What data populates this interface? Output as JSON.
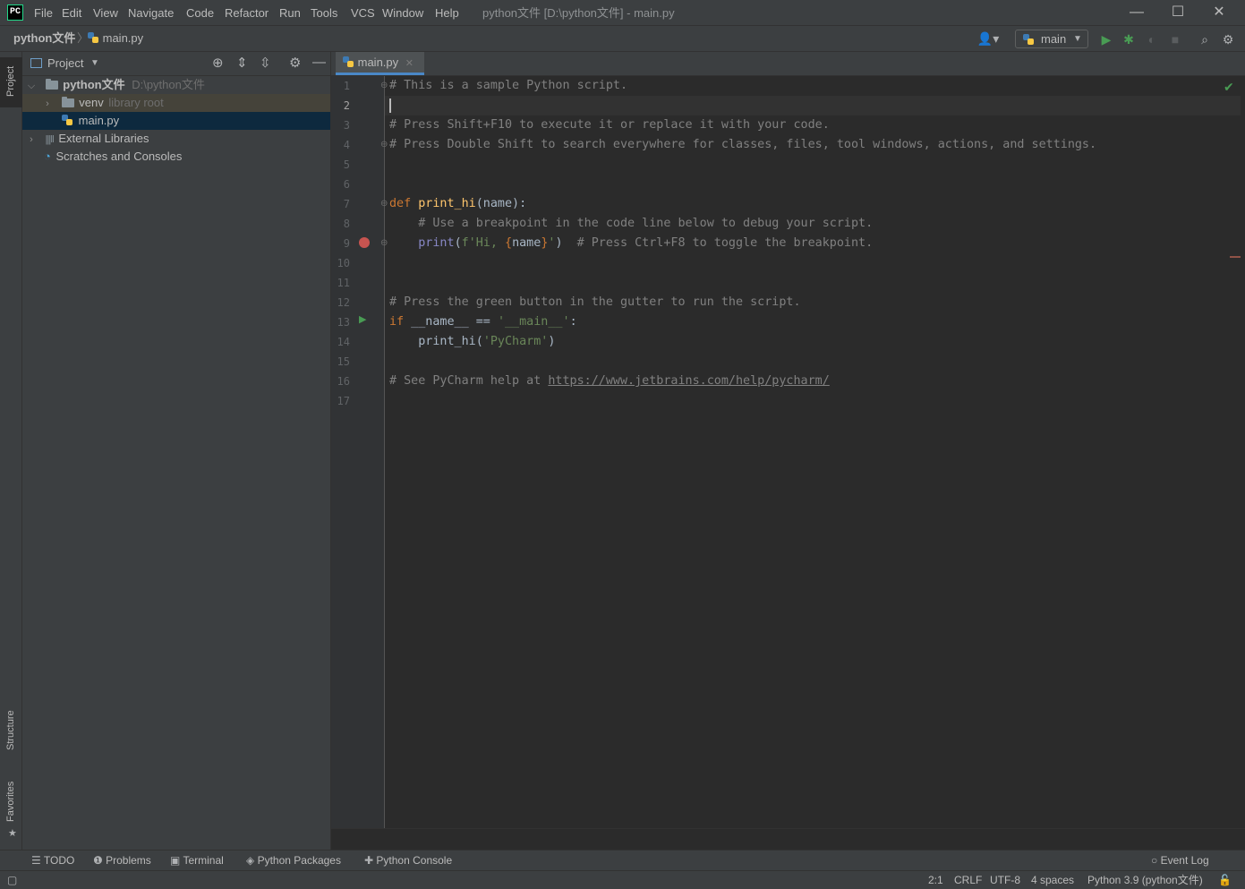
{
  "titlebar": {
    "logo": "PC",
    "menu": [
      "File",
      "Edit",
      "View",
      "Navigate",
      "Code",
      "Refactor",
      "Run",
      "Tools",
      "VCS",
      "Window",
      "Help"
    ],
    "window_title": "python文件 [D:\\python文件] - main.py",
    "controls": {
      "minimize": "—",
      "maximize": "☐",
      "close": "✕"
    }
  },
  "navbar": {
    "breadcrumb_root": "python文件",
    "breadcrumb_file": "main.py",
    "run_config": "main"
  },
  "left_stripe": {
    "project": "Project",
    "structure": "Structure",
    "favorites": "Favorites"
  },
  "project_panel": {
    "title": "Project",
    "tree": {
      "root_name": "python文件",
      "root_path": "D:\\python文件",
      "venv_name": "venv",
      "venv_hint": "library root",
      "main_file": "main.py",
      "external_libraries": "External Libraries",
      "scratches": "Scratches and Consoles"
    }
  },
  "editor": {
    "tab_label": "main.py",
    "line_numbers": [
      "1",
      "2",
      "3",
      "4",
      "5",
      "6",
      "7",
      "8",
      "9",
      "10",
      "11",
      "12",
      "13",
      "14",
      "15",
      "16",
      "17"
    ],
    "code": {
      "l1": "# This is a sample Python script.",
      "l3": "# Press Shift+F10 to execute it or replace it with your code.",
      "l4": "# Press Double Shift to search everywhere for classes, files, tool windows, actions, and settings.",
      "l7_kw": "def",
      "l7_fn": "print_hi",
      "l7_rest": "(name):",
      "l8": "# Use a breakpoint in the code line below to debug your script.",
      "l9_builtin": "print",
      "l9_open": "(",
      "l9_str1": "f'Hi, ",
      "l9_brace_open": "{",
      "l9_var": "name",
      "l9_brace_close": "}",
      "l9_str2": "'",
      "l9_close": ")",
      "l9_comment": "# Press Ctrl+F8 to toggle the breakpoint.",
      "l12": "# Press the green button in the gutter to run the script.",
      "l13_kw": "if",
      "l13_mid": " __name__ == ",
      "l13_str": "'__main__'",
      "l13_end": ":",
      "l14_fn": "print_hi(",
      "l14_str": "'PyCharm'",
      "l14_end": ")",
      "l16_text": "# See PyCharm help at ",
      "l16_link": "https://www.jetbrains.com/help/pycharm/"
    }
  },
  "bottom_tabs": {
    "todo": "TODO",
    "problems": "Problems",
    "terminal": "Terminal",
    "python_packages": "Python Packages",
    "python_console": "Python Console",
    "event_log": "Event Log"
  },
  "status_bar": {
    "position": "2:1",
    "line_sep": "CRLF",
    "encoding": "UTF-8",
    "indent": "4 spaces",
    "interpreter": "Python 3.9 (python文件)"
  },
  "colors": {
    "background": "#2b2b2b",
    "panel": "#3c3f41",
    "keyword": "#cc7832",
    "function": "#ffc66d",
    "string": "#6a8759",
    "comment": "#808080",
    "breakpoint": "#c75450",
    "run_green": "#499c54"
  }
}
